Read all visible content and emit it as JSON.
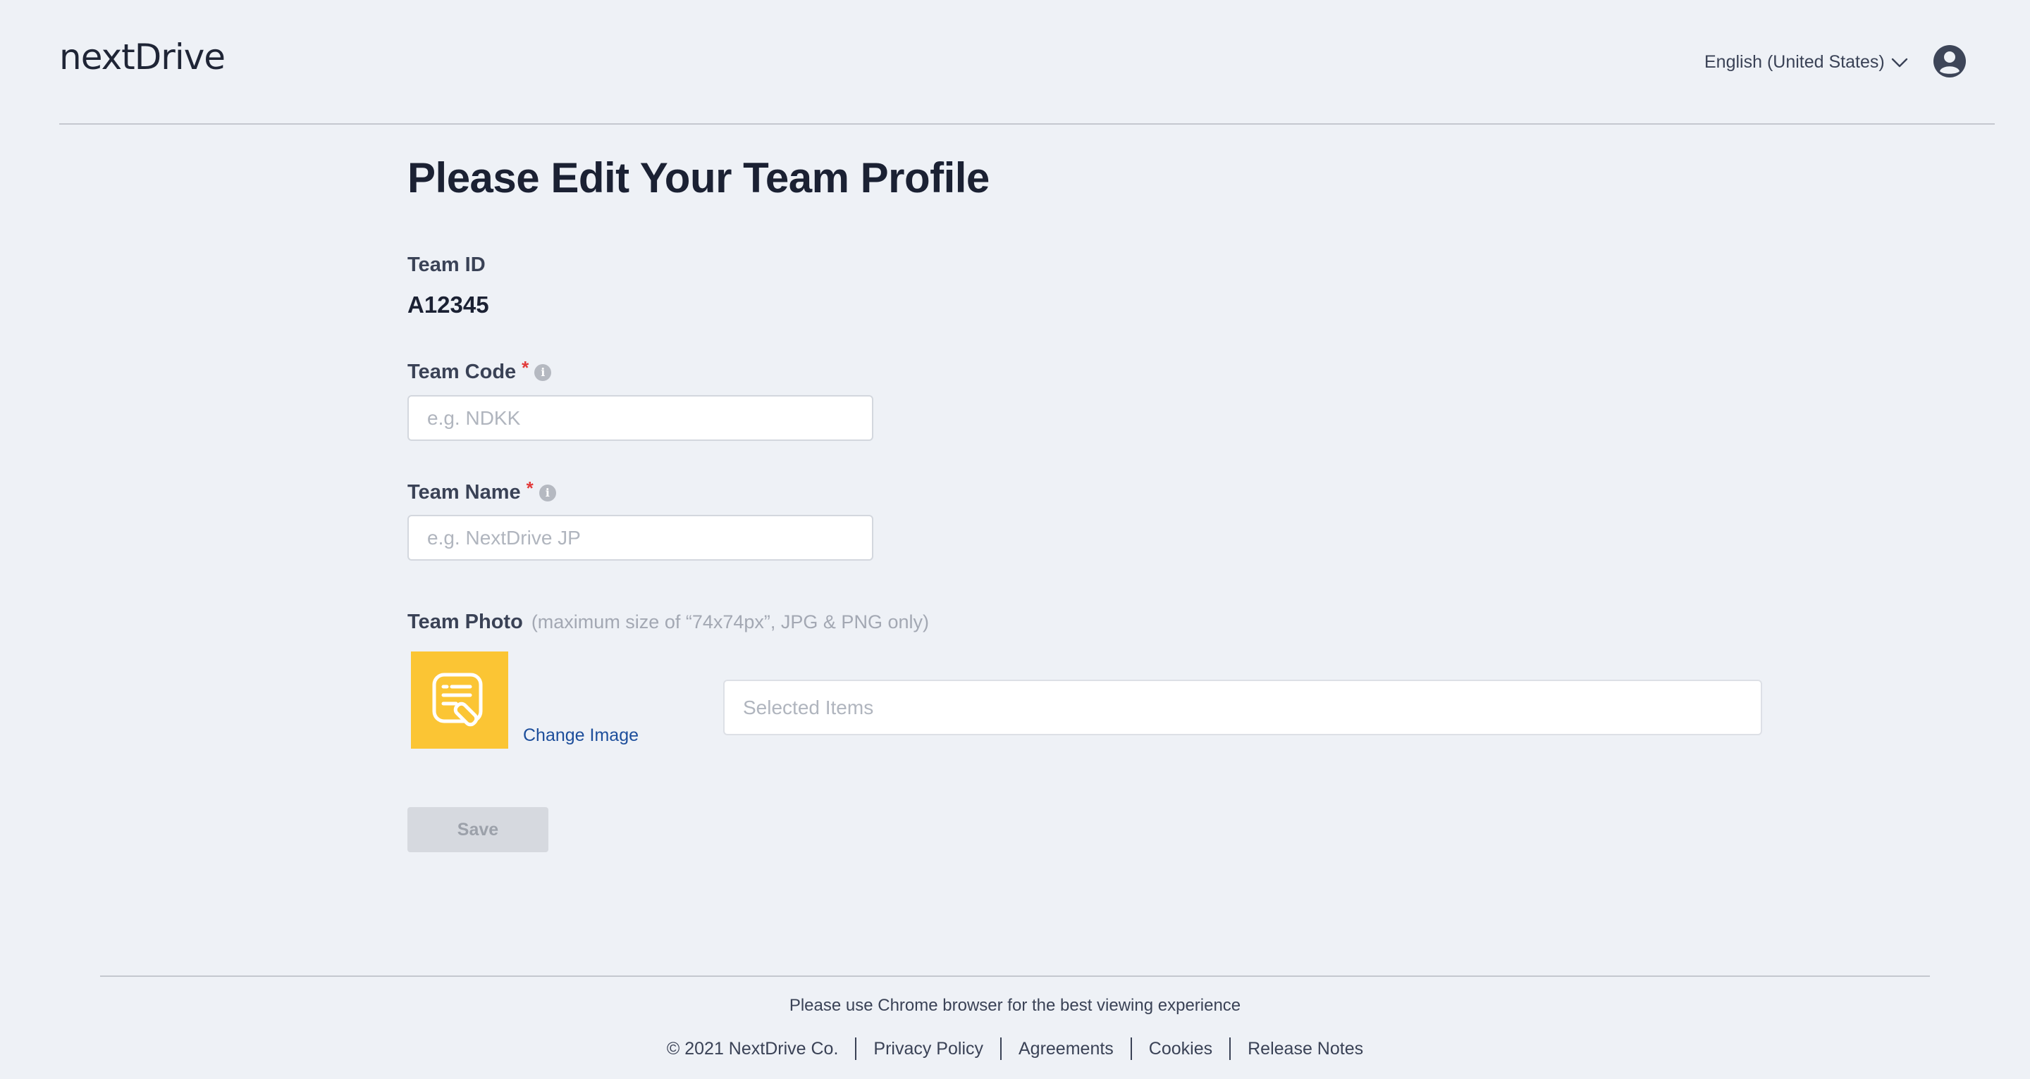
{
  "header": {
    "logo": "nextDrive",
    "language": "English (United States)",
    "language_icon": "chevron-down-icon",
    "avatar_icon": "user-avatar-icon"
  },
  "main": {
    "title": "Please Edit Your Team Profile",
    "team_id": {
      "label": "Team ID",
      "value": "A12345"
    },
    "team_code": {
      "label": "Team Code",
      "required_mark": "*",
      "info_icon": "i",
      "placeholder": "e.g. NDKK",
      "value": ""
    },
    "team_name": {
      "label": "Team Name",
      "required_mark": "*",
      "info_icon": "i",
      "placeholder": "e.g. NextDrive JP",
      "value": ""
    },
    "team_photo": {
      "label": "Team Photo",
      "hint": "(maximum size of “74x74px”, JPG & PNG only)",
      "icon": "document-edit-icon",
      "icon_bg": "#fbc534",
      "change_label": "Change Image",
      "selected_placeholder": "Selected Items"
    },
    "save_label": "Save"
  },
  "footer": {
    "note": "Please use Chrome browser for the best viewing experience",
    "links": [
      "© 2021 NextDrive Co.",
      "Privacy Policy",
      "Agreements",
      "Cookies",
      "Release Notes"
    ]
  },
  "colors": {
    "background": "#eef1f6",
    "accent_link": "#1d4e9b",
    "required": "#e23a3a",
    "photo_tile": "#fbc534",
    "save_disabled_bg": "#d6d9df"
  }
}
